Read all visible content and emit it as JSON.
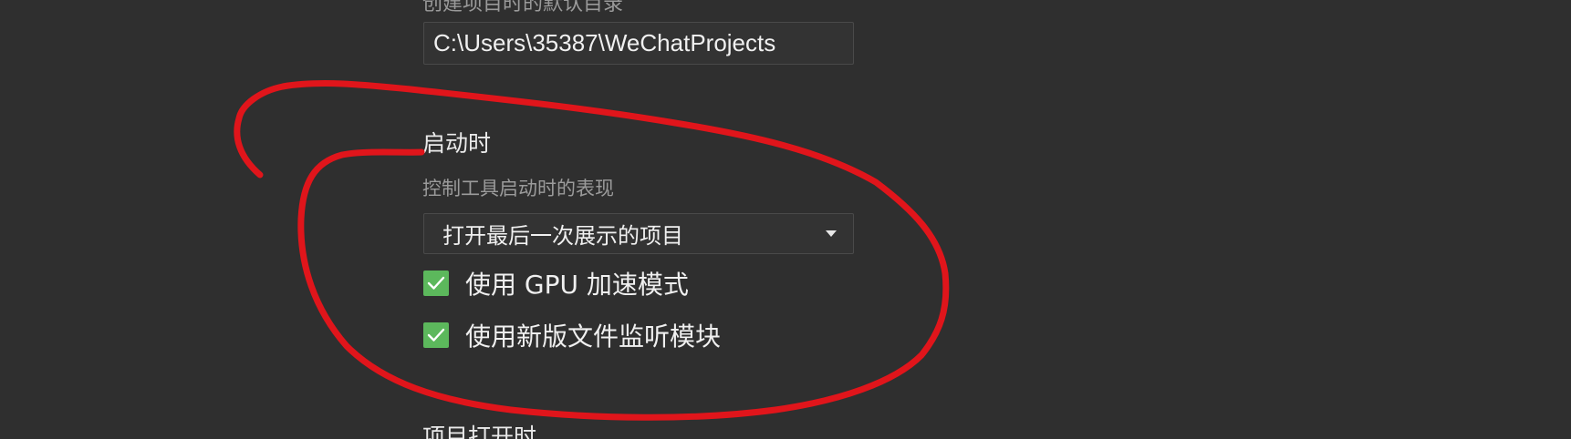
{
  "project_dir": {
    "label": "创建项目时的默认目录",
    "value": "C:\\Users\\35387\\WeChatProjects"
  },
  "startup": {
    "title": "启动时",
    "description": "控制工具启动时的表现",
    "select_value": "打开最后一次展示的项目",
    "options": [
      {
        "label": "使用 GPU 加速模式",
        "checked": true
      },
      {
        "label": "使用新版文件监听模块",
        "checked": true
      }
    ]
  },
  "next_section": {
    "title": "项目打开时"
  },
  "colors": {
    "background": "#2f2f2f",
    "checkbox": "#5cb85c",
    "annotation": "#e0151b"
  },
  "icons": {
    "dropdown": "caret-down-icon",
    "checkbox": "checkmark-icon"
  }
}
